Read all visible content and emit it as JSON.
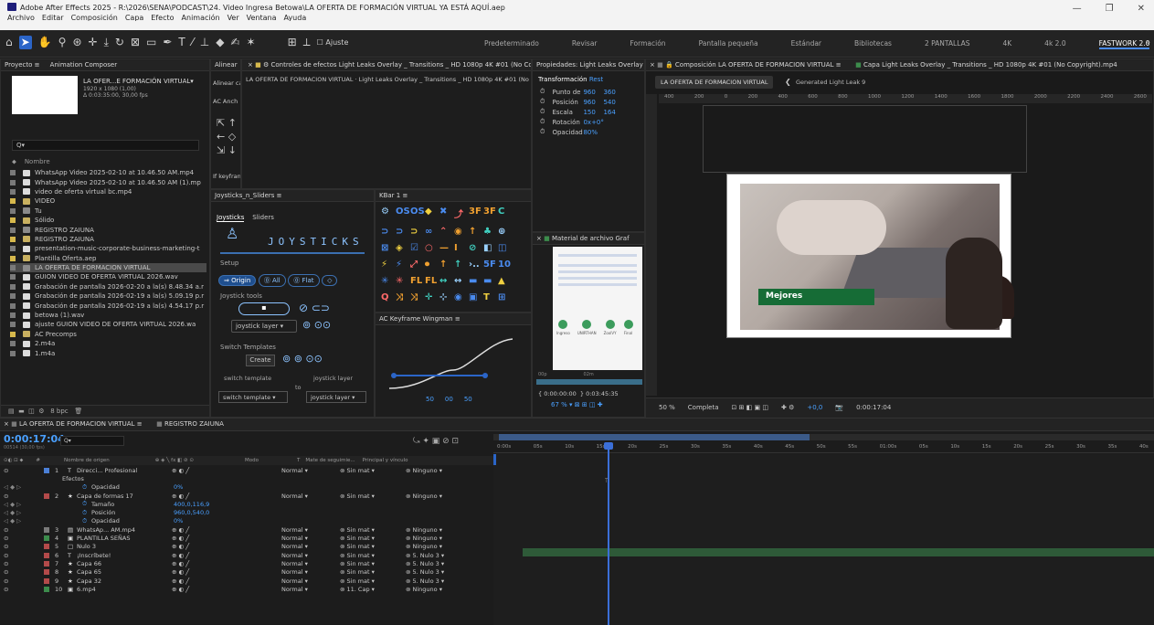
{
  "window": {
    "title": "Adobe After Effects 2025 - R:\\2026\\SENA\\PODCAST\\24. Video Ingresa Betowa\\LA OFERTA DE FORMACIÓN VIRTUAL YA ESTÁ AQUÍ.aep",
    "minimize": "—",
    "maximize": "❐",
    "close": "✕"
  },
  "menu": [
    "Archivo",
    "Editar",
    "Composición",
    "Capa",
    "Efecto",
    "Animación",
    "Ver",
    "Ventana",
    "Ayuda"
  ],
  "toolbar": {
    "align_label": "Ajuste",
    "workspaces": [
      "Predeterminado",
      "Revisar",
      "Formación",
      "Pantalla pequeña",
      "Estándar",
      "Bibliotecas",
      "2 PANTALLAS",
      "4K",
      "4k 2.0",
      "FASTWORK 2.0"
    ],
    "more": "»"
  },
  "project": {
    "tab1": "Proyecto",
    "tab2": "Animation Composer",
    "thumb_title": "LA OFER...E FORMACIÓN VIRTUAL▾",
    "thumb_size": "1920 x 1080 (1,00)",
    "thumb_dur": "Δ 0:03:35:00, 30,00 fps",
    "search_placeholder": "Q▾",
    "col_name": "Nombre",
    "items": [
      {
        "name": "WhatsApp Video 2025-02-10 at 10.46.50 AM.mp4",
        "color": "#7a7a7a",
        "type": "file"
      },
      {
        "name": "WhatsApp Video 2025-02-10 at 10.46.50 AM (1).mp",
        "color": "#7a7a7a",
        "type": "file"
      },
      {
        "name": "video de oferta virtual bc.mp4",
        "color": "#7a7a7a",
        "type": "file"
      },
      {
        "name": "VIDEO",
        "color": "#d6b84c",
        "type": "folder"
      },
      {
        "name": "Tu",
        "color": "#7a7a7a",
        "type": "comp"
      },
      {
        "name": "Sólido",
        "color": "#d6b84c",
        "type": "folder"
      },
      {
        "name": "REGISTRO ZAIUNA",
        "color": "#7a7a7a",
        "type": "comp"
      },
      {
        "name": "REGISTRO ZAIUNA",
        "color": "#d6b84c",
        "type": "folder"
      },
      {
        "name": "presentation-music-corporate-business-marketing-t",
        "color": "#7a7a7a",
        "type": "audio"
      },
      {
        "name": "Plantilla Oferta.aep",
        "color": "#d6b84c",
        "type": "folder"
      },
      {
        "name": "LA OFERTA DE FORMACION VIRTUAL",
        "color": "#7a7a7a",
        "type": "comp",
        "selected": true
      },
      {
        "name": "GUION VIDEO DE OFERTA VIRTUAL 2026.wav",
        "color": "#7a7a7a",
        "type": "audio"
      },
      {
        "name": "Grabación de pantalla 2026-02-20 a la(s) 8.48.34 a.r",
        "color": "#7a7a7a",
        "type": "file"
      },
      {
        "name": "Grabación de pantalla 2026-02-19 a la(s) 5.09.19 p.r",
        "color": "#7a7a7a",
        "type": "file"
      },
      {
        "name": "Grabación de pantalla 2026-02-19 a la(s) 4.54.17 p.r",
        "color": "#7a7a7a",
        "type": "file"
      },
      {
        "name": "betowa (1).wav",
        "color": "#7a7a7a",
        "type": "audio"
      },
      {
        "name": "ajuste GUION VIDEO DE OFERTA VIRTUAL 2026.wa",
        "color": "#7a7a7a",
        "type": "audio"
      },
      {
        "name": "AC Precomps",
        "color": "#d6b84c",
        "type": "folder"
      },
      {
        "name": "2.m4a",
        "color": "#7a7a7a",
        "type": "audio"
      },
      {
        "name": "1.m4a",
        "color": "#7a7a7a",
        "type": "audio"
      }
    ],
    "bpc": "8 bpc"
  },
  "align": {
    "tab": "Alinear",
    "line1": "Alinear ca",
    "line2": "AC Anch",
    "keyframe": "If keyfran"
  },
  "effects": {
    "tab": "Controles de efectos Light Leaks Overlay _ Transitions _ HD 1080p 4K #01 (No Copyri",
    "path": "LA OFERTA DE FORMACION VIRTUAL · Light Leaks Overlay _ Transitions _ HD 1080p 4K #01 (No"
  },
  "props": {
    "tab": "Propiedades: Light Leaks Overlay _",
    "section": "Transformación",
    "reset": "Rest",
    "rows": [
      {
        "label": "Punto de",
        "v1": "960",
        "v2": "360"
      },
      {
        "label": "Posición",
        "v1": "960",
        "v2": "540"
      },
      {
        "label": "Escala",
        "v1": "150",
        "v2": "164"
      },
      {
        "label": "Rotación",
        "v1": "0x+0°",
        "v2": ""
      },
      {
        "label": "Opacidad",
        "v1": "80%",
        "v2": ""
      }
    ]
  },
  "comp": {
    "tab": "Composición LA OFERTA DE FORMACION VIRTUAL",
    "tab2": "Capa Light Leaks Overlay _ Transitions _ HD 1080p 4K #01 (No Copyright).mp4",
    "crumb1": "LA OFERTA DE FORMACION VIRTUAL",
    "crumb2": "Generated Light Leak 9",
    "ruler": [
      "400",
      "200",
      "0",
      "200",
      "400",
      "600",
      "800",
      "1000",
      "1200",
      "1400",
      "1600",
      "1800",
      "2000",
      "2200",
      "2400",
      "2600"
    ],
    "overlay": "Mejores",
    "zoom": "50 %",
    "quality": "Completa",
    "exposure": "+0,0",
    "timecode": "0:00:17:04"
  },
  "joysticks": {
    "tab": "Joysticks_n_Sliders",
    "sub1": "Joysticks",
    "sub2": "Sliders",
    "title": "JOYSTICKS",
    "setup": "Setup",
    "origin": "Origin",
    "all": "All",
    "flat": "Flat",
    "tools": "Joystick tools",
    "layer1": "joystick layer",
    "switch": "Switch Templates",
    "create": "Create",
    "sw_template": "switch template",
    "js_layer": "joystick layer",
    "to": "to",
    "sel1": "switch template",
    "sel2": "joystick layer"
  },
  "kbar": {
    "tab": "KBar 1",
    "rows": [
      [
        "⚙",
        "OS",
        "OS",
        "◆",
        "✖",
        "⤴",
        "3F",
        "3F",
        "C"
      ],
      [
        "⊃",
        "⊃",
        "⊃",
        "∞",
        "⌃",
        "◉",
        "↑",
        "♣",
        "⊕"
      ],
      [
        "⊠",
        "◈",
        "☑",
        "○",
        "—",
        "Ⅰ",
        "⊘",
        "◧",
        "◫"
      ],
      [
        "⚡",
        "⚡",
        "⤢",
        "⏺",
        "↑",
        "↑",
        "›..",
        "5F",
        "10"
      ],
      [
        "✳",
        "✳",
        "FL",
        "FL",
        "↔",
        "↔",
        "▬",
        "▬",
        "▲"
      ],
      [
        "Q",
        "⤨",
        "⤨",
        "✛",
        "⊹",
        "◉",
        "▣",
        "T",
        "⊞"
      ]
    ],
    "footer": [
      "50",
      "00",
      "50"
    ]
  },
  "footage": {
    "tab": "Material de archivo Graf",
    "labels": [
      "Ingreso",
      "UNIRTHAN",
      "ZoolVY",
      "Final"
    ],
    "t1": "0:00:00:00",
    "t2": "0:03:45:35",
    "zoom": "67 %",
    "ticks": [
      "00p",
      "02m"
    ]
  },
  "wingman": {
    "tab": "AC Keyframe Wingman"
  },
  "timeline": {
    "tab1": "LA OFERTA DE FORMACION VIRTUAL",
    "tab2": "REGISTRO ZAIUNA",
    "tc": "0:00:17:04",
    "frames": "00514 (30,00 fps)",
    "search": "Q▾",
    "col_num": "#",
    "col_name": "Nombre de origen",
    "col_mode": "Modo",
    "col_t": "T",
    "col_trk": "Mate de seguimie...",
    "col_parent": "Principal y vínculo",
    "ruler": [
      "0:00s",
      "05s",
      "10s",
      "15s",
      "20s",
      "25s",
      "30s",
      "35s",
      "40s",
      "45s",
      "50s",
      "55s",
      "01:00s",
      "05s",
      "10s",
      "15s",
      "20s",
      "25s",
      "30s",
      "35s",
      "40s"
    ],
    "rows": [
      {
        "num": "1",
        "name": "Direcci... Profesional",
        "color": "#4b7fd6",
        "icon": "T",
        "mode": "Normal",
        "trk": "Sin mat",
        "parent": "Ninguno",
        "bar": false
      },
      {
        "sub": "Efectos"
      },
      {
        "prop": "Opacidad",
        "value": "0%"
      },
      {
        "num": "2",
        "name": "Capa de formas 17",
        "color": "#b34a4a",
        "icon": "★",
        "mode": "Normal",
        "trk": "Sin mat",
        "parent": "Ninguno",
        "bar": false
      },
      {
        "prop": "Tamaño",
        "value": "400,0,116,9"
      },
      {
        "prop": "Posición",
        "value": "960,0,540,0"
      },
      {
        "prop": "Opacidad",
        "value": "0%"
      },
      {
        "num": "3",
        "name": "WhatsAp... AM.mp4",
        "color": "#7a7a7a",
        "icon": "▤",
        "mode": "Normal",
        "trk": "Sin mat",
        "parent": "Ninguno",
        "bar": false
      },
      {
        "num": "4",
        "name": "PLANTILLA SEÑAS",
        "color": "#3c8c4c",
        "icon": "▣",
        "mode": "Normal",
        "trk": "Sin mat",
        "parent": "Ninguno",
        "bar": true
      },
      {
        "num": "5",
        "name": "Nulo 3",
        "color": "#b34a4a",
        "icon": "□",
        "mode": "Normal",
        "trk": "Sin mat",
        "parent": "Ninguno",
        "bar": false
      },
      {
        "num": "6",
        "name": "¡Inscríbete!",
        "color": "#b34a4a",
        "icon": "T",
        "mode": "Normal",
        "trk": "Sin mat",
        "parent": "5. Nulo 3",
        "bar": false
      },
      {
        "num": "7",
        "name": "Capa 66",
        "color": "#b34a4a",
        "icon": "★",
        "mode": "Normal",
        "trk": "Sin mat",
        "parent": "5. Nulo 3",
        "bar": false
      },
      {
        "num": "8",
        "name": "Capa 65",
        "color": "#b34a4a",
        "icon": "★",
        "mode": "Normal",
        "trk": "Sin mat",
        "parent": "5. Nulo 3",
        "bar": false
      },
      {
        "num": "9",
        "name": "Capa 32",
        "color": "#b34a4a",
        "icon": "★",
        "mode": "Normal",
        "trk": "Sin mat",
        "parent": "5. Nulo 3",
        "bar": false
      },
      {
        "num": "10",
        "name": "6.mp4",
        "color": "#3c8c4c",
        "icon": "▣",
        "mode": "Normal",
        "trk": "11. Cap",
        "parent": "Ninguno",
        "bar": false
      }
    ]
  }
}
